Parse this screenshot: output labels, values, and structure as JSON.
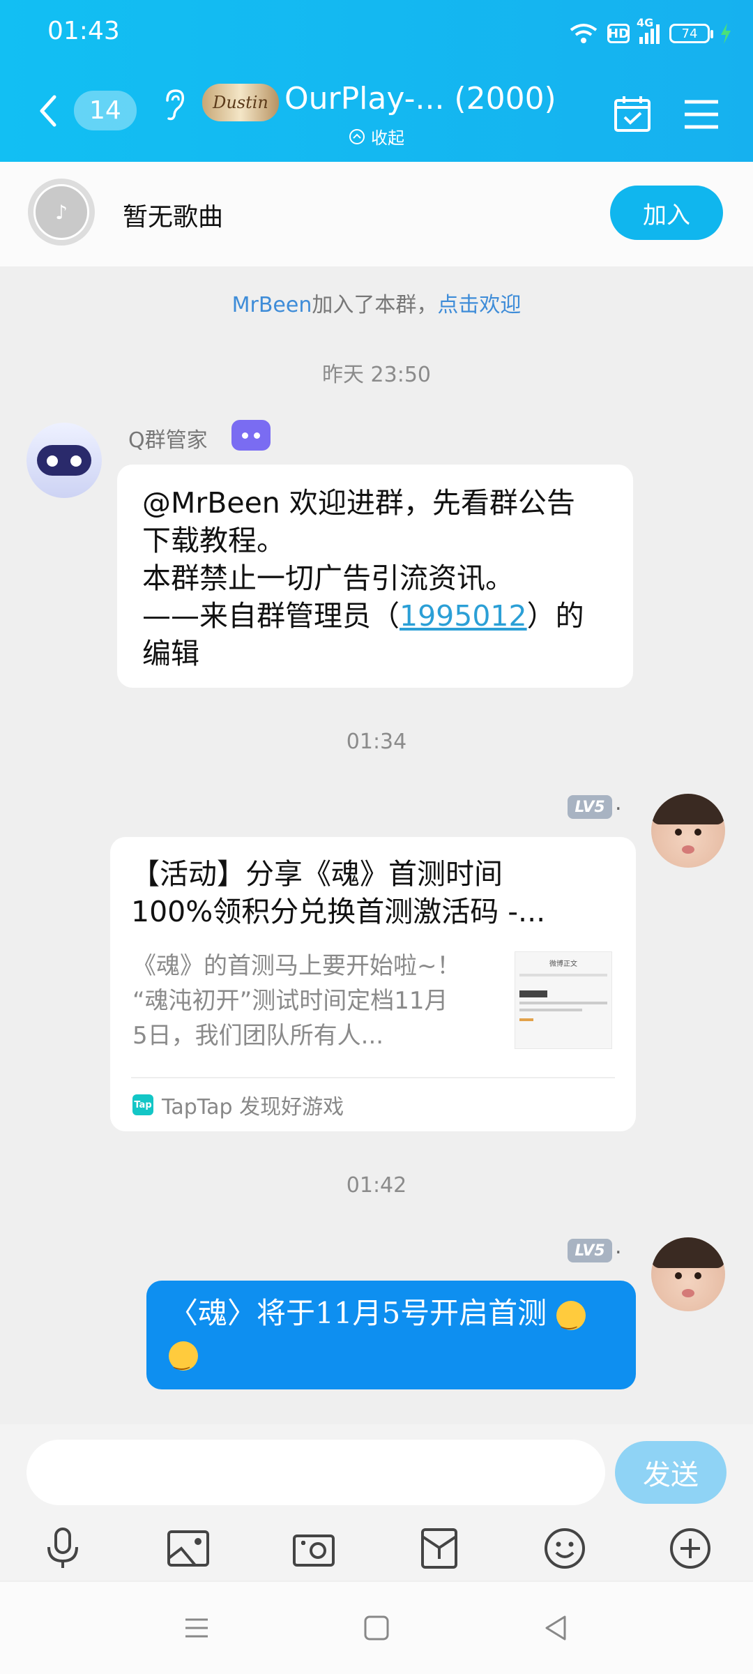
{
  "status": {
    "time": "01:43",
    "hd": "HD",
    "network": "4G",
    "battery": "74"
  },
  "header": {
    "back_count": "14",
    "logo_text": "Dustin",
    "title": "OurPlay-...  (2000)",
    "collapse_label": "收起"
  },
  "music": {
    "label": "暂无歌曲",
    "join_label": "加入"
  },
  "chat": {
    "notice": {
      "name": "MrBeen",
      "text": "加入了本群，",
      "link": "点击欢迎"
    },
    "time1": "昨天 23:50",
    "bot": {
      "name": "Q群管家",
      "line1": "@MrBeen 欢迎进群，先看群公告",
      "line2": "下载教程。",
      "line3": "本群禁止一切广告引流资讯。",
      "line4_prefix": "——来自群管理员（",
      "line4_link": "1995012",
      "line4_suffix": "）的",
      "line5": "编辑"
    },
    "time2": "01:34",
    "msg2": {
      "level": "LV5",
      "dot": ".",
      "card_title_1": "【活动】分享《魂》首测时间",
      "card_title_2": "100%领积分兑换首测激活码 -...",
      "card_desc_1": "《魂》的首测马上要开始啦~！",
      "card_desc_2": "“魂沌初开”测试时间定档11月",
      "card_desc_3": "5日，我们团队所有人...",
      "source_icon": "Tap",
      "source": "TapTap 发现好游戏",
      "thumb_title": "微博正文"
    },
    "time3": "01:42",
    "msg3": {
      "level": "LV5",
      "dot": ".",
      "text": "〈魂〉将于11月5号开启首测"
    }
  },
  "input": {
    "value": "",
    "send_label": "发送"
  },
  "colors": {
    "header": "#12bff3",
    "accent": "#10b6ee",
    "blue_bubble": "#0e8ff0",
    "link": "#3e8cd8"
  }
}
